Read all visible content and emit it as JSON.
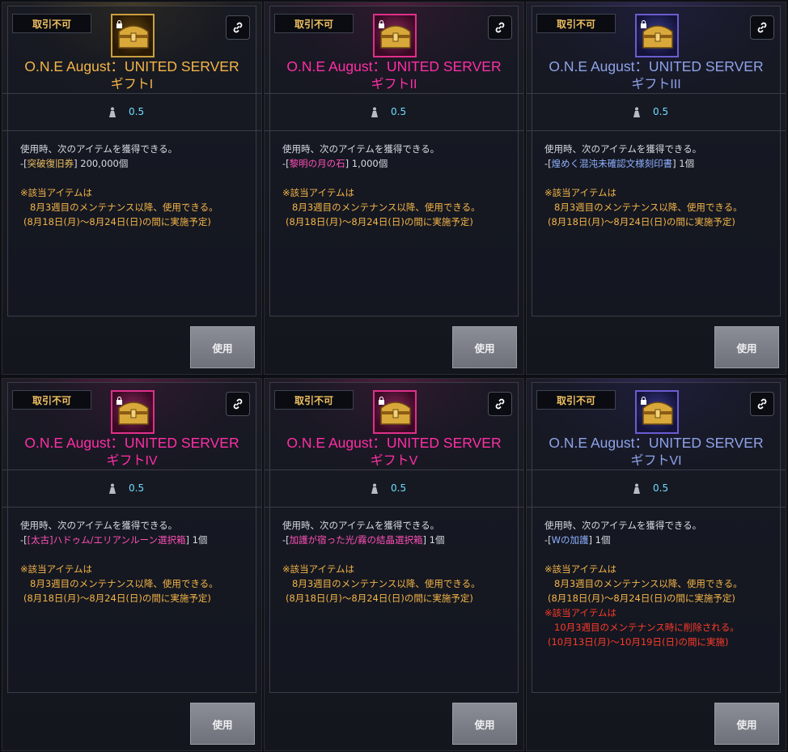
{
  "colors": {
    "gold": "#f5b548",
    "pink": "#ff2fa6",
    "blue": "#8fa2ea",
    "weight": "#6fdcff",
    "warning_red": "#ff3a2a"
  },
  "common": {
    "tradeable_badge": "取引不可",
    "weight_value": "0.5",
    "use_button": "使用",
    "link_icon": "link-icon",
    "weight_icon": "weight-icon",
    "intro": "使用時、次のアイテムを獲得できる。",
    "note_title": "※該当アイテムは",
    "note_line1": "8月3週目のメンテナンス以降、使用できる。",
    "note_line2": "(8月18日(月)～8月24日(日)の間に実施予定)"
  },
  "cards": [
    {
      "title_line1": "O.N.E August：UNITED SERVER",
      "title_line2": "ギフトI",
      "reward_prefix": "-[",
      "reward_name": "突破復旧券",
      "reward_suffix": "]",
      "reward_qty": "200,000個"
    },
    {
      "title_line1": "O.N.E August：UNITED SERVER",
      "title_line2": "ギフトII",
      "reward_prefix": "-[",
      "reward_name": "黎明の月の石",
      "reward_suffix": "]",
      "reward_qty": "1,000個"
    },
    {
      "title_line1": "O.N.E August：UNITED SERVER",
      "title_line2": "ギフトIII",
      "reward_prefix": "-[",
      "reward_name": "煌めく混沌未確認文様刻印書",
      "reward_suffix": "]",
      "reward_qty": "1個"
    },
    {
      "title_line1": "O.N.E August：UNITED SERVER",
      "title_line2": "ギフトIV",
      "reward_prefix": "-[",
      "reward_name": "[太古]ハドゥム/エリアンルーン選択箱",
      "reward_suffix": "]",
      "reward_qty": "1個"
    },
    {
      "title_line1": "O.N.E August：UNITED SERVER",
      "title_line2": "ギフトV",
      "reward_prefix": "-[",
      "reward_name": "加護が宿った光/霧の結晶選択箱",
      "reward_suffix": "]",
      "reward_qty": "1個"
    },
    {
      "title_line1": "O.N.E August：UNITED SERVER",
      "title_line2": "ギフトVI",
      "reward_prefix": "-[",
      "reward_name": "Wの加護",
      "reward_suffix": "]",
      "reward_qty": "1個",
      "extra_note_title": "※該当アイテムは",
      "extra_note_line1": "10月3週目のメンテナンス時に削除される。",
      "extra_note_line2": "(10月13日(月)～10月19日(日)の間に実施)"
    }
  ]
}
